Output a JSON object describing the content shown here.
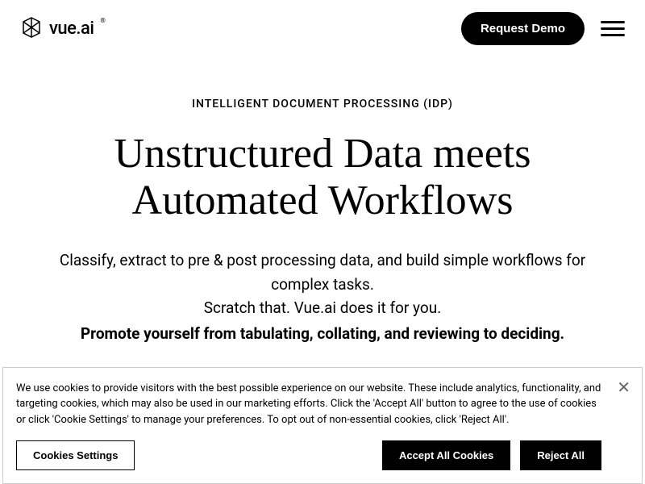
{
  "header": {
    "logo_text": "vue.ai",
    "request_demo_label": "Request Demo"
  },
  "hero": {
    "eyebrow": "INTELLIGENT DOCUMENT PROCESSING (IDP)",
    "title": "Unstructured Data meets Automated Workflows",
    "description_line1": "Classify, extract to pre & post processing data, and build simple workflows for complex tasks.",
    "description_line2": "Scratch that. Vue.ai does it for you.",
    "bold_line": "Promote yourself from tabulating, collating, and reviewing to deciding."
  },
  "cookie": {
    "text": "We use cookies to provide visitors with the best possible experience on our website. These include analytics, functionality, and targeting cookies, which may also be used in our marketing efforts. Click the 'Accept All' button to agree to the use of cookies or click 'Cookie Settings' to manage your preferences. To opt out of non-essential cookies, click 'Reject All'.",
    "settings_label": "Cookies Settings",
    "accept_label": "Accept All Cookies",
    "reject_label": "Reject All"
  }
}
